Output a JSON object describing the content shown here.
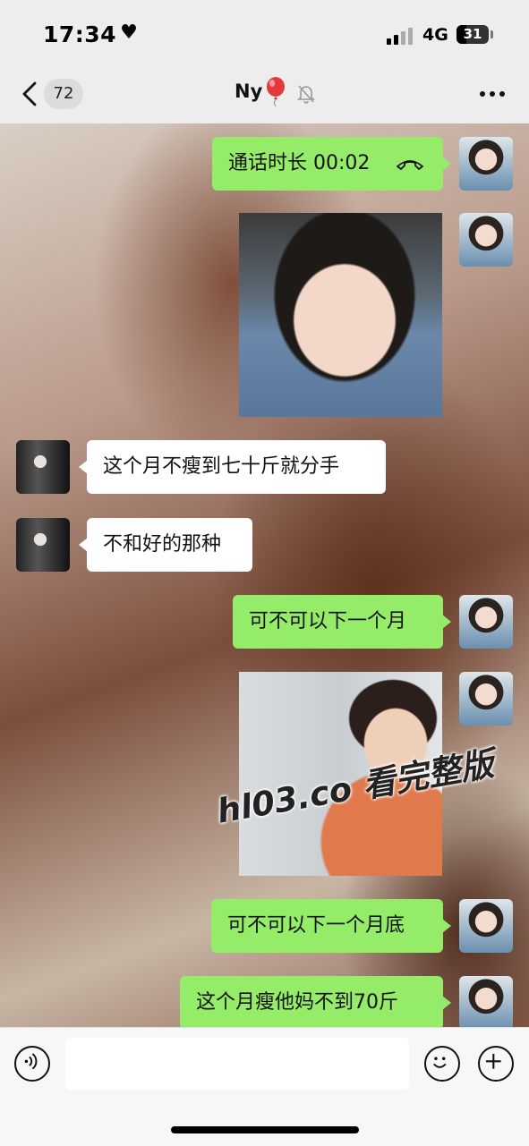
{
  "status_bar": {
    "time": "17:34",
    "network": "4G",
    "battery": "31"
  },
  "nav": {
    "unread_count": "72",
    "title": "Ny"
  },
  "messages": [
    {
      "side": "me",
      "type": "call",
      "text": "通话时长 00:02"
    },
    {
      "side": "me",
      "type": "image"
    },
    {
      "side": "other",
      "type": "text",
      "text": "这个月不瘦到七十斤就分手"
    },
    {
      "side": "other",
      "type": "text",
      "text": "不和好的那种"
    },
    {
      "side": "me",
      "type": "text",
      "text": "可不可以下一个月"
    },
    {
      "side": "me",
      "type": "image"
    },
    {
      "side": "me",
      "type": "text",
      "text": "可不可以下一个月底"
    },
    {
      "side": "me",
      "type": "text",
      "text": "这个月瘦他妈不到70斤"
    }
  ],
  "watermark": "hl03.co 看完整版",
  "icons": {
    "back": "chevron-left-icon",
    "balloon": "balloon-emoji-icon",
    "mute": "mute-bell-icon",
    "more": "more-dots-icon",
    "call": "phone-hangup-icon",
    "voice": "voice-icon",
    "emoji": "emoji-icon",
    "plus": "plus-icon"
  },
  "colors": {
    "my_bubble": "#95ec69",
    "other_bubble": "#ffffff",
    "bar_bg": "#ededed"
  }
}
